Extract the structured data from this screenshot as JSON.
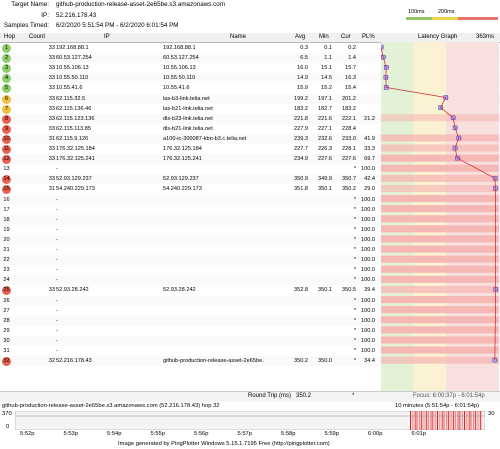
{
  "header": {
    "target_label": "Target Name:",
    "target_value": "github-production-release-asset-2e65be.s3.amazonaws.com",
    "ip_label": "IP:",
    "ip_value": "52.216.178.43",
    "samples_label": "Samples Timed:",
    "samples_value": "6/2/2020 5:51:54 PM - 6/2/2020 6:01:54 PM"
  },
  "legend": {
    "left": "100ms",
    "right": "200ms",
    "colors": [
      "#e7e7e7",
      "#93c66b",
      "#e8d24e",
      "#e8736a"
    ]
  },
  "columns": {
    "hop": "Hop",
    "count": "Count",
    "ip": "IP",
    "name": "Name",
    "avg": "Avg",
    "min": "Min",
    "cur": "Cur",
    "pl": "PL%",
    "graph": "Latency Graph",
    "max": "363ms"
  },
  "hops": [
    {
      "hop": "1",
      "count": "33",
      "ip": "192.168.88.1",
      "name": "192.168.88.1",
      "avg": "0.3",
      "min": "0.1",
      "cur": "0.2",
      "pl": "",
      "color": "#8fcf6a"
    },
    {
      "hop": "2",
      "count": "33",
      "ip": "60.53.127.254",
      "name": "60.53.127.254",
      "avg": "6.5",
      "min": "1.1",
      "cur": "1.4",
      "pl": "",
      "color": "#8fcf6a"
    },
    {
      "hop": "3",
      "count": "33",
      "ip": "10.55.106.13",
      "name": "10.55.106.13",
      "avg": "16.0",
      "min": "15.1",
      "cur": "15.7",
      "pl": "",
      "color": "#8fcf6a"
    },
    {
      "hop": "4",
      "count": "33",
      "ip": "10.55.50.110",
      "name": "10.55.50.110",
      "avg": "14.9",
      "min": "14.5",
      "cur": "16.3",
      "pl": "",
      "color": "#8fcf6a"
    },
    {
      "hop": "5",
      "count": "33",
      "ip": "10.55.41.6",
      "name": "10.55.41.6",
      "avg": "15.9",
      "min": "15.2",
      "cur": "15.4",
      "pl": "",
      "color": "#8fcf6a"
    },
    {
      "hop": "6",
      "count": "33",
      "ip": "62.115.32.5",
      "name": "las-b3-link.telia.net",
      "avg": "199.2",
      "min": "197.1",
      "cur": "201.2",
      "pl": "",
      "color": "#f0c040"
    },
    {
      "hop": "7",
      "count": "33",
      "ip": "62.115.136.46",
      "name": "las-b21-link.telia.net",
      "avg": "183.2",
      "min": "182.7",
      "cur": "183.2",
      "pl": "",
      "color": "#f0c040"
    },
    {
      "hop": "8",
      "count": "33",
      "ip": "62.115.123.136",
      "name": "dls-b23-link.telia.net",
      "avg": "221.8",
      "min": "221.6",
      "cur": "222.1",
      "pl": "21.2",
      "color": "#e8604f"
    },
    {
      "hop": "9",
      "count": "33",
      "ip": "62.115.113.85",
      "name": "dls-b21-link.telia.net",
      "avg": "227.9",
      "min": "227.1",
      "cur": "228.4",
      "pl": "",
      "color": "#e8604f"
    },
    {
      "hop": "10",
      "count": "31",
      "ip": "62.115.9.126",
      "name": "a100-ic-300087-kbn-b3.c.telia.net",
      "avg": "239.3",
      "min": "232.6",
      "cur": "233.0",
      "pl": "41.9",
      "color": "#e8604f"
    },
    {
      "hop": "11",
      "count": "33",
      "ip": "176.32.125.184",
      "name": "176.32.125.184",
      "avg": "227.7",
      "min": "226.3",
      "cur": "228.1",
      "pl": "33.3",
      "color": "#e8604f"
    },
    {
      "hop": "12",
      "count": "33",
      "ip": "176.32.125.241",
      "name": "176.32.125.241",
      "avg": "234.9",
      "min": "227.6",
      "cur": "227.6",
      "pl": "69.7",
      "color": "#e8604f"
    },
    {
      "hop": "13",
      "count": "",
      "ip": "-",
      "name": "",
      "avg": "",
      "min": "",
      "cur": "*",
      "pl": "100.0",
      "color": ""
    },
    {
      "hop": "14",
      "count": "33",
      "ip": "52.93.129.237",
      "name": "52.93.129.237",
      "avg": "350.9",
      "min": "349.9",
      "cur": "350.7",
      "pl": "42.4",
      "color": "#e8604f"
    },
    {
      "hop": "15",
      "count": "31",
      "ip": "54.240.229.173",
      "name": "54.240.229.173",
      "avg": "351.8",
      "min": "350.1",
      "cur": "350.2",
      "pl": "29.0",
      "color": "#e8604f"
    },
    {
      "hop": "16",
      "count": "",
      "ip": "-",
      "name": "",
      "avg": "",
      "min": "",
      "cur": "*",
      "pl": "100.0",
      "color": ""
    },
    {
      "hop": "17",
      "count": "",
      "ip": "-",
      "name": "",
      "avg": "",
      "min": "",
      "cur": "*",
      "pl": "100.0",
      "color": ""
    },
    {
      "hop": "18",
      "count": "",
      "ip": "-",
      "name": "",
      "avg": "",
      "min": "",
      "cur": "*",
      "pl": "100.0",
      "color": ""
    },
    {
      "hop": "19",
      "count": "",
      "ip": "-",
      "name": "",
      "avg": "",
      "min": "",
      "cur": "*",
      "pl": "100.0",
      "color": ""
    },
    {
      "hop": "20",
      "count": "",
      "ip": "-",
      "name": "",
      "avg": "",
      "min": "",
      "cur": "*",
      "pl": "100.0",
      "color": ""
    },
    {
      "hop": "21",
      "count": "",
      "ip": "-",
      "name": "",
      "avg": "",
      "min": "",
      "cur": "*",
      "pl": "100.0",
      "color": ""
    },
    {
      "hop": "22",
      "count": "",
      "ip": "-",
      "name": "",
      "avg": "",
      "min": "",
      "cur": "*",
      "pl": "100.0",
      "color": ""
    },
    {
      "hop": "23",
      "count": "",
      "ip": "-",
      "name": "",
      "avg": "",
      "min": "",
      "cur": "*",
      "pl": "100.0",
      "color": ""
    },
    {
      "hop": "24",
      "count": "",
      "ip": "-",
      "name": "",
      "avg": "",
      "min": "",
      "cur": "*",
      "pl": "100.0",
      "color": ""
    },
    {
      "hop": "25",
      "count": "33",
      "ip": "52.93.28.242",
      "name": "52.93.28.242",
      "avg": "352.8",
      "min": "350.1",
      "cur": "350.5",
      "pl": "39.4",
      "color": "#e8604f"
    },
    {
      "hop": "26",
      "count": "",
      "ip": "-",
      "name": "",
      "avg": "",
      "min": "",
      "cur": "*",
      "pl": "100.0",
      "color": ""
    },
    {
      "hop": "27",
      "count": "",
      "ip": "-",
      "name": "",
      "avg": "",
      "min": "",
      "cur": "*",
      "pl": "100.0",
      "color": ""
    },
    {
      "hop": "28",
      "count": "",
      "ip": "-",
      "name": "",
      "avg": "",
      "min": "",
      "cur": "*",
      "pl": "100.0",
      "color": ""
    },
    {
      "hop": "29",
      "count": "",
      "ip": "-",
      "name": "",
      "avg": "",
      "min": "",
      "cur": "*",
      "pl": "100.0",
      "color": ""
    },
    {
      "hop": "30",
      "count": "",
      "ip": "-",
      "name": "",
      "avg": "",
      "min": "",
      "cur": "*",
      "pl": "100.0",
      "color": ""
    },
    {
      "hop": "31",
      "count": "",
      "ip": "-",
      "name": "",
      "avg": "",
      "min": "",
      "cur": "*",
      "pl": "100.0",
      "color": ""
    },
    {
      "hop": "32",
      "count": "32",
      "ip": "52.216.178.43",
      "name": "github-production-release-asset-2e65be.",
      "avg": "350.2",
      "min": "350.0",
      "cur": "*",
      "pl": "34.4",
      "color": "#e8604f"
    }
  ],
  "roundtrip": {
    "label": "Round Trip (ms)",
    "avg": "350.2",
    "cur": "*",
    "focus": "Focus: 6:00:37p - 6:01:54p"
  },
  "footer": {
    "left": "github-production-release-asset-2e65be.s3.amazonaws.com (52.216.178.43) hop 32",
    "right": "10 minutes (5:51:54p - 6:01:54p)",
    "yhi": "370",
    "ylo": "0",
    "pl": "30",
    "times": [
      "5:52p",
      "5:53p",
      "5:54p",
      "5:55p",
      "5:56p",
      "5:57p",
      "5:58p",
      "5:59p",
      "6:00p",
      "6:01p"
    ],
    "generated": "Image generated by PingPlotter Windows 5.15.1.7195 Free (http://pingplotter.com)"
  }
}
